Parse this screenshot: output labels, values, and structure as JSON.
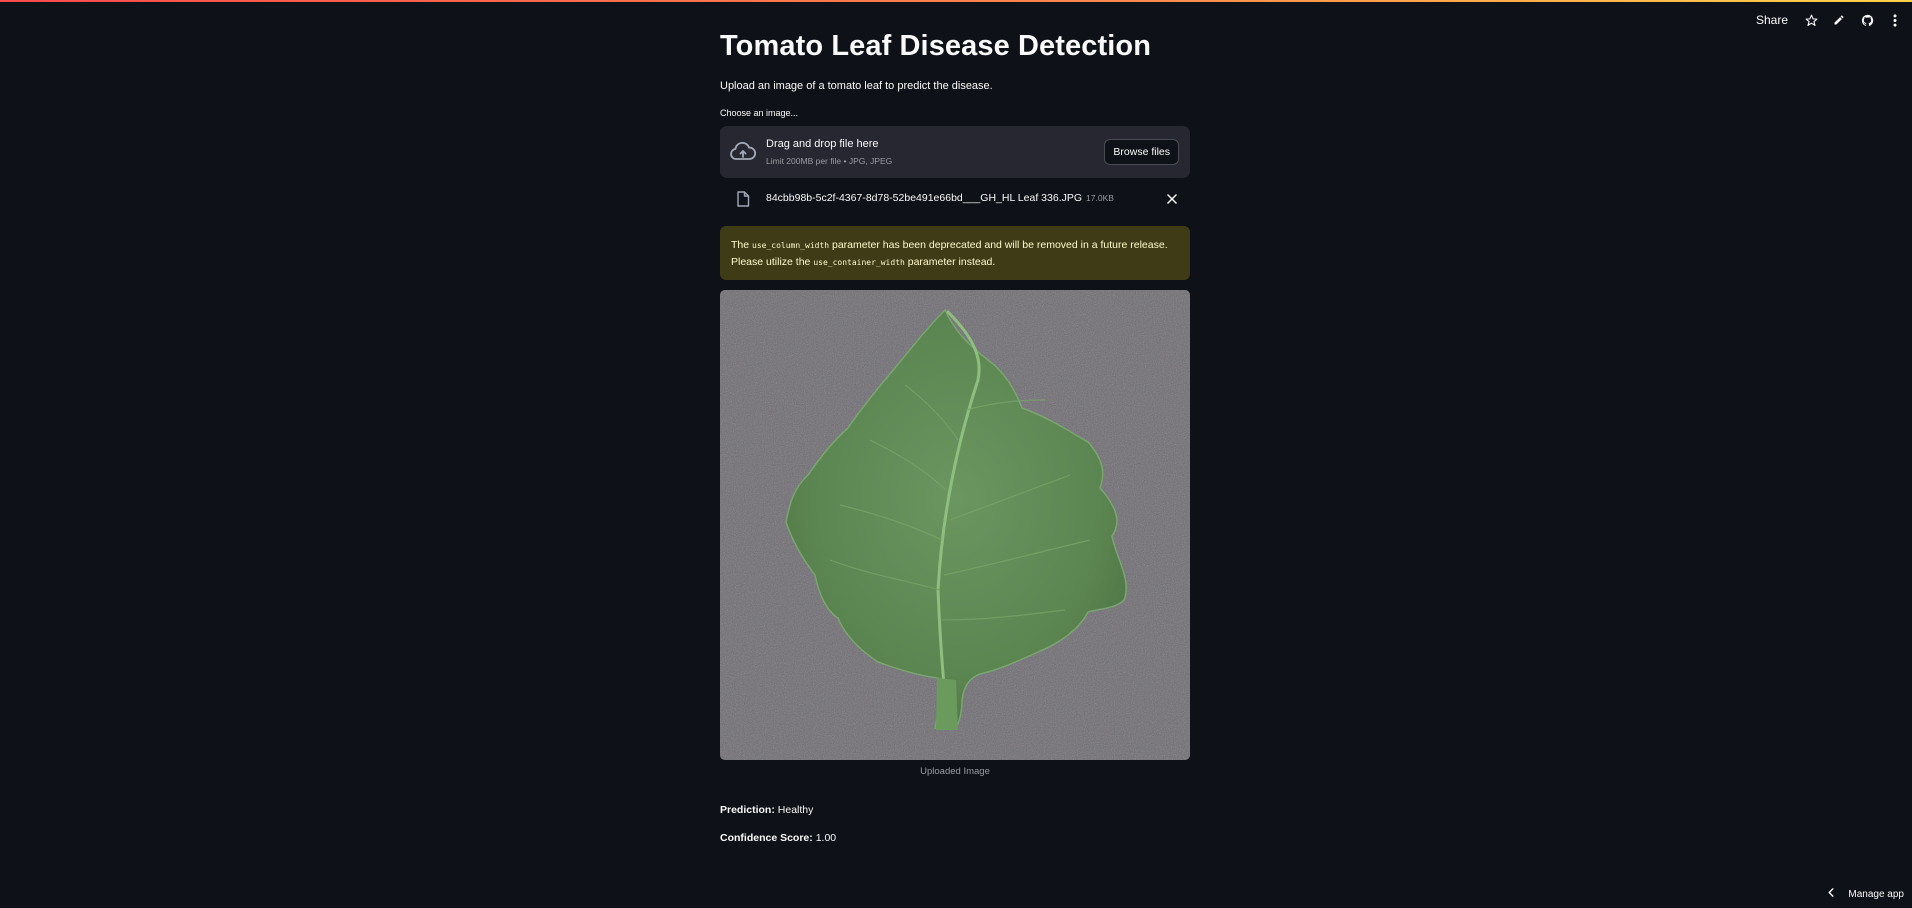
{
  "toolbar": {
    "share_label": "Share",
    "icons": [
      "star-icon",
      "pencil-icon",
      "github-icon",
      "more-vertical-icon"
    ]
  },
  "page": {
    "title": "Tomato Leaf Disease Detection",
    "subtitle": "Upload an image of a tomato leaf to predict the disease."
  },
  "uploader": {
    "label": "Choose an image...",
    "drop_title": "Drag and drop file here",
    "limit_text": "Limit 200MB per file • JPG, JPEG",
    "browse_label": "Browse files",
    "file": {
      "name": "84cbb98b-5c2f-4367-8d78-52be491e66bd___GH_HL Leaf 336.JPG",
      "size": "17.0KB"
    }
  },
  "warning": {
    "prefix": "The",
    "code1": "use_column_width",
    "middle": "parameter has been deprecated and will be removed in a future release. Please utilize the",
    "code2": "use_container_width",
    "suffix": "parameter instead."
  },
  "image": {
    "caption": "Uploaded Image"
  },
  "result": {
    "prediction_label": "Prediction:",
    "prediction_value": "Healthy",
    "confidence_label": "Confidence Score:",
    "confidence_value": "1.00"
  },
  "footer": {
    "manage_label": "Manage app"
  },
  "colors": {
    "background": "#0e1117",
    "panel": "#262730",
    "warning_bg": "#3e3b16",
    "warning_text": "#fffacd",
    "leaf": "#5f8a55"
  }
}
